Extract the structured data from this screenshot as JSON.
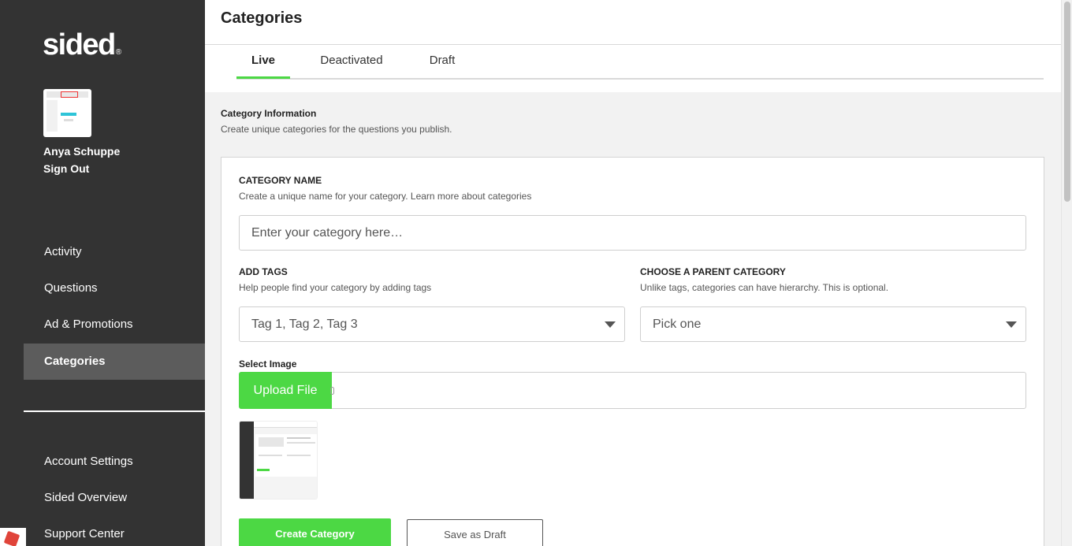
{
  "sidebar": {
    "logo": "sided",
    "logo_mark": "®",
    "user_name": "Anya Schuppe",
    "sign_out": "Sign Out",
    "nav": [
      "Activity",
      "Questions",
      "Ad & Promotions",
      "Categories"
    ],
    "active_nav": "Categories",
    "bottom_nav": [
      "Account Settings",
      "Sided Overview",
      "Support Center"
    ]
  },
  "header": {
    "title": "Categories"
  },
  "tabs": [
    "Live",
    "Deactivated",
    "Draft"
  ],
  "active_tab": "Live",
  "section": {
    "title": "Category Information",
    "subtitle": "Create unique categories for the questions you publish."
  },
  "form": {
    "name_label": "CATEGORY NAME",
    "name_hint": "Create a unique name for your category. Learn more about categories",
    "name_placeholder": "Enter your category here…",
    "tags_label": "ADD TAGS",
    "tags_hint": "Help people find your category by adding tags",
    "tags_value": "Tag 1, Tag 2, Tag 3",
    "parent_label": "CHOOSE A PARENT CATEGORY",
    "parent_hint": "Unlike tags, categories can have hierarchy. This is optional.",
    "parent_value": "Pick one",
    "image_label": "Select Image",
    "upload_label": "Upload File",
    "create_label": "Create Category",
    "draft_label": "Save as Draft"
  },
  "colors": {
    "sidebar_bg": "#333333",
    "active_nav_bg": "#5c5c5c",
    "accent_green": "#4cd844"
  }
}
